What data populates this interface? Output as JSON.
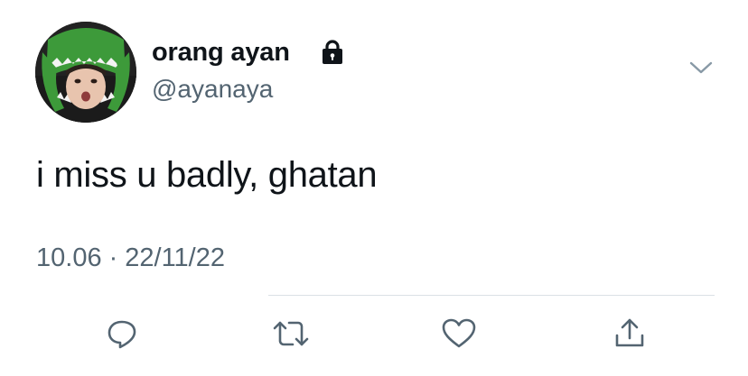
{
  "tweet": {
    "display_name": "orang ayan",
    "handle": "@ayanaya",
    "text": "i miss u badly, ghatan",
    "time": "10.06",
    "separator": "·",
    "date": "22/11/22",
    "protected": true
  },
  "icons": {
    "lock": "lock-icon",
    "menu": "chevron-down-icon",
    "reply": "reply-icon",
    "retweet": "retweet-icon",
    "like": "heart-icon",
    "share": "share-icon"
  },
  "colors": {
    "text": "#0f1419",
    "secondary": "#536471",
    "divider": "#dbe1e6",
    "avatar_green": "#3d9a3a"
  }
}
